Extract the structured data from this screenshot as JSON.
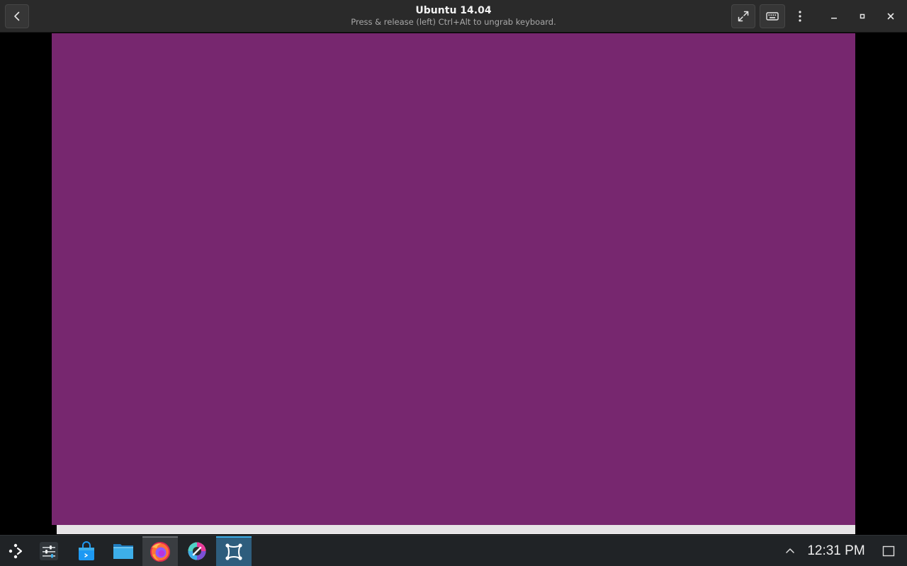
{
  "window": {
    "title": "Ubuntu 14.04",
    "subtitle": "Press & release (left) Ctrl+Alt to ungrab keyboard."
  },
  "header_buttons": {
    "back_icon": "chevron-left-icon",
    "fullscreen_icon": "fullscreen-icon",
    "keyboard_icon": "keyboard-icon",
    "menu_icon": "kebab-menu-icon",
    "minimize_icon": "minimize-icon",
    "maximize_icon": "maximize-icon",
    "close_icon": "close-icon"
  },
  "vm_display": {
    "background_color": "#77276f",
    "bottom_strip_color": "#e6e4e6"
  },
  "taskbar": {
    "items": [
      {
        "name": "application-launcher",
        "icon": "launcher-icon"
      },
      {
        "name": "system-settings",
        "icon": "settings-sliders-icon"
      },
      {
        "name": "software-store",
        "icon": "store-bag-icon"
      },
      {
        "name": "file-manager",
        "icon": "folder-icon"
      },
      {
        "name": "firefox",
        "icon": "firefox-icon"
      },
      {
        "name": "krita",
        "icon": "krita-icon"
      },
      {
        "name": "virtual-machine-manager",
        "icon": "vm-manager-icon"
      }
    ],
    "clock": "12:31 PM",
    "tray_arrow_icon": "chevron-up-icon",
    "show_desktop_icon": "show-desktop-icon"
  },
  "colors": {
    "header_bg": "#2a2a2a",
    "taskbar_bg": "#202326",
    "accent": "#3daee9"
  }
}
